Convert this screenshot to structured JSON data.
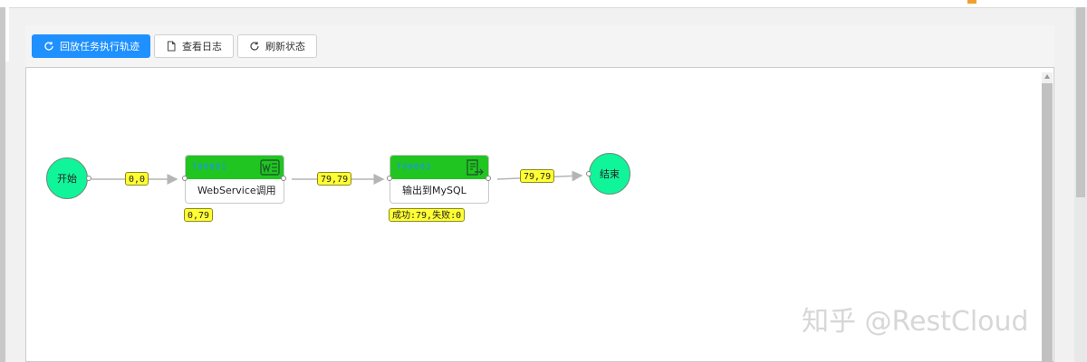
{
  "toolbar": {
    "replay_label": "回放任务执行轨迹",
    "log_label": "查看日志",
    "refresh_label": "刷新状态"
  },
  "flow": {
    "start_label": "开始",
    "end_label": "结束",
    "tasks": [
      {
        "code": "T00001",
        "name": "WebService调用",
        "icon": "webservice-icon",
        "stat": "0,79"
      },
      {
        "code": "T00003",
        "name": "输出到MySQL",
        "icon": "export-icon",
        "stat": "成功:79,失败:0"
      }
    ],
    "edges": [
      {
        "label": "0,0"
      },
      {
        "label": "79,79"
      },
      {
        "label": "79,79"
      }
    ]
  },
  "watermark": "知乎 @RestCloud",
  "colors": {
    "primary": "#1e90ff",
    "node_green": "#11f59a",
    "task_header": "#21c521",
    "badge": "#ffff33",
    "task_code": "#1e8fff"
  }
}
